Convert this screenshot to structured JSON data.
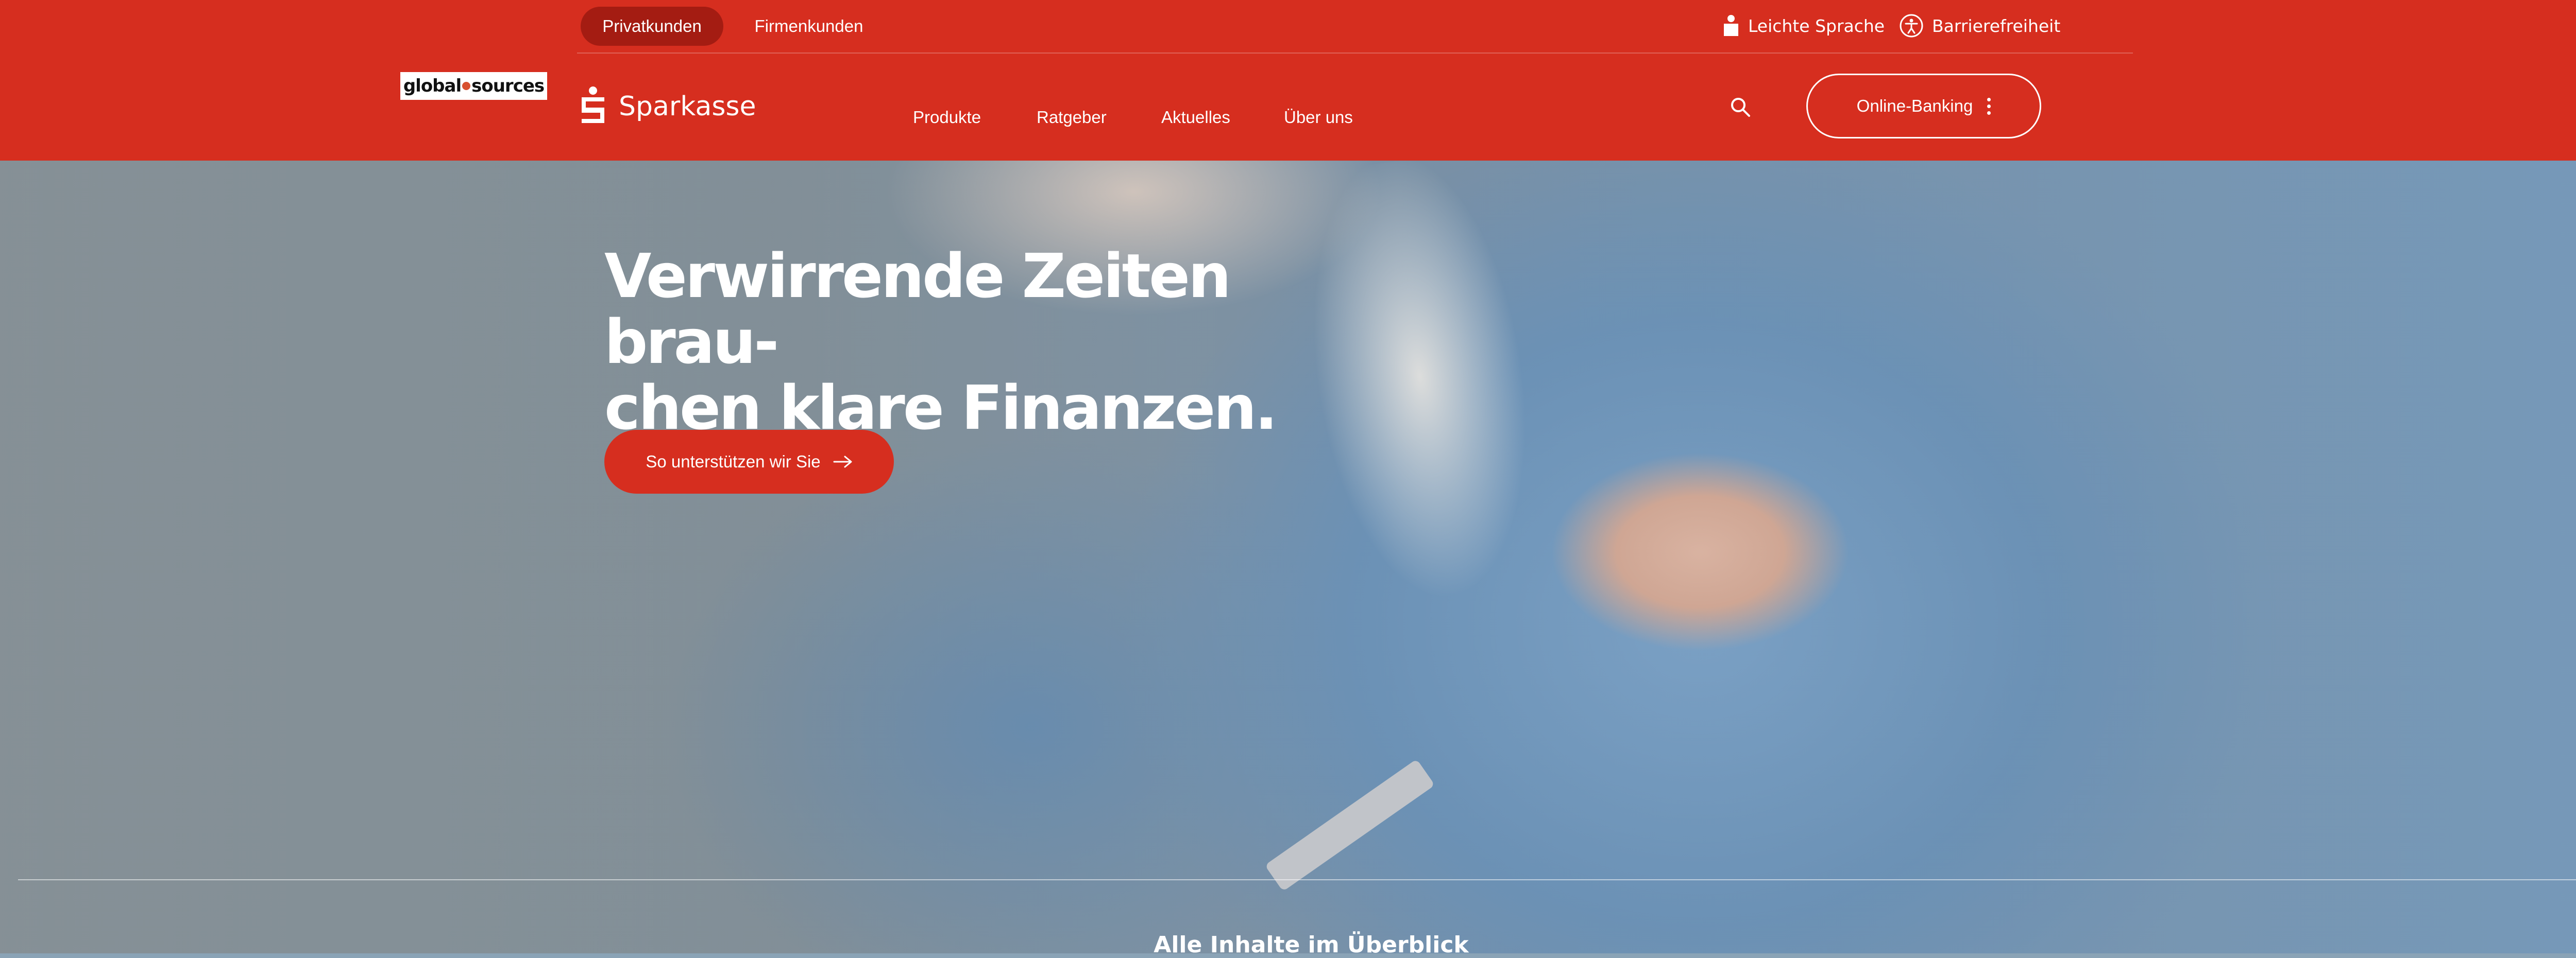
{
  "header": {
    "segments": {
      "privat": "Privatkunden",
      "firmen": "Firmenkunden"
    },
    "utility": {
      "leichte_sprache": "Leichte Sprache",
      "barrierefreiheit": "Barrierefreiheit"
    },
    "global_sources_logo": {
      "left": "global",
      "right": "sources"
    },
    "brand": "Sparkasse",
    "nav": [
      "Produkte",
      "Ratgeber",
      "Aktuelles",
      "Über uns"
    ],
    "online_banking": "Online-Banking"
  },
  "hero": {
    "headline_line1": "Verwirrende Zeiten brau-",
    "headline_line2": "chen klare Finanzen.",
    "cta_label": "So unterstützen wir Sie"
  },
  "section": {
    "overview_title": "Alle Inhalte im Überblick"
  },
  "colors": {
    "brand_red": "#d62e1f",
    "active_segment": "#a41c12"
  },
  "icons": [
    "leichte-sprache-icon",
    "accessibility-icon",
    "sparkasse-s-icon",
    "search-icon",
    "kebab-menu-icon",
    "arrow-right-icon"
  ]
}
